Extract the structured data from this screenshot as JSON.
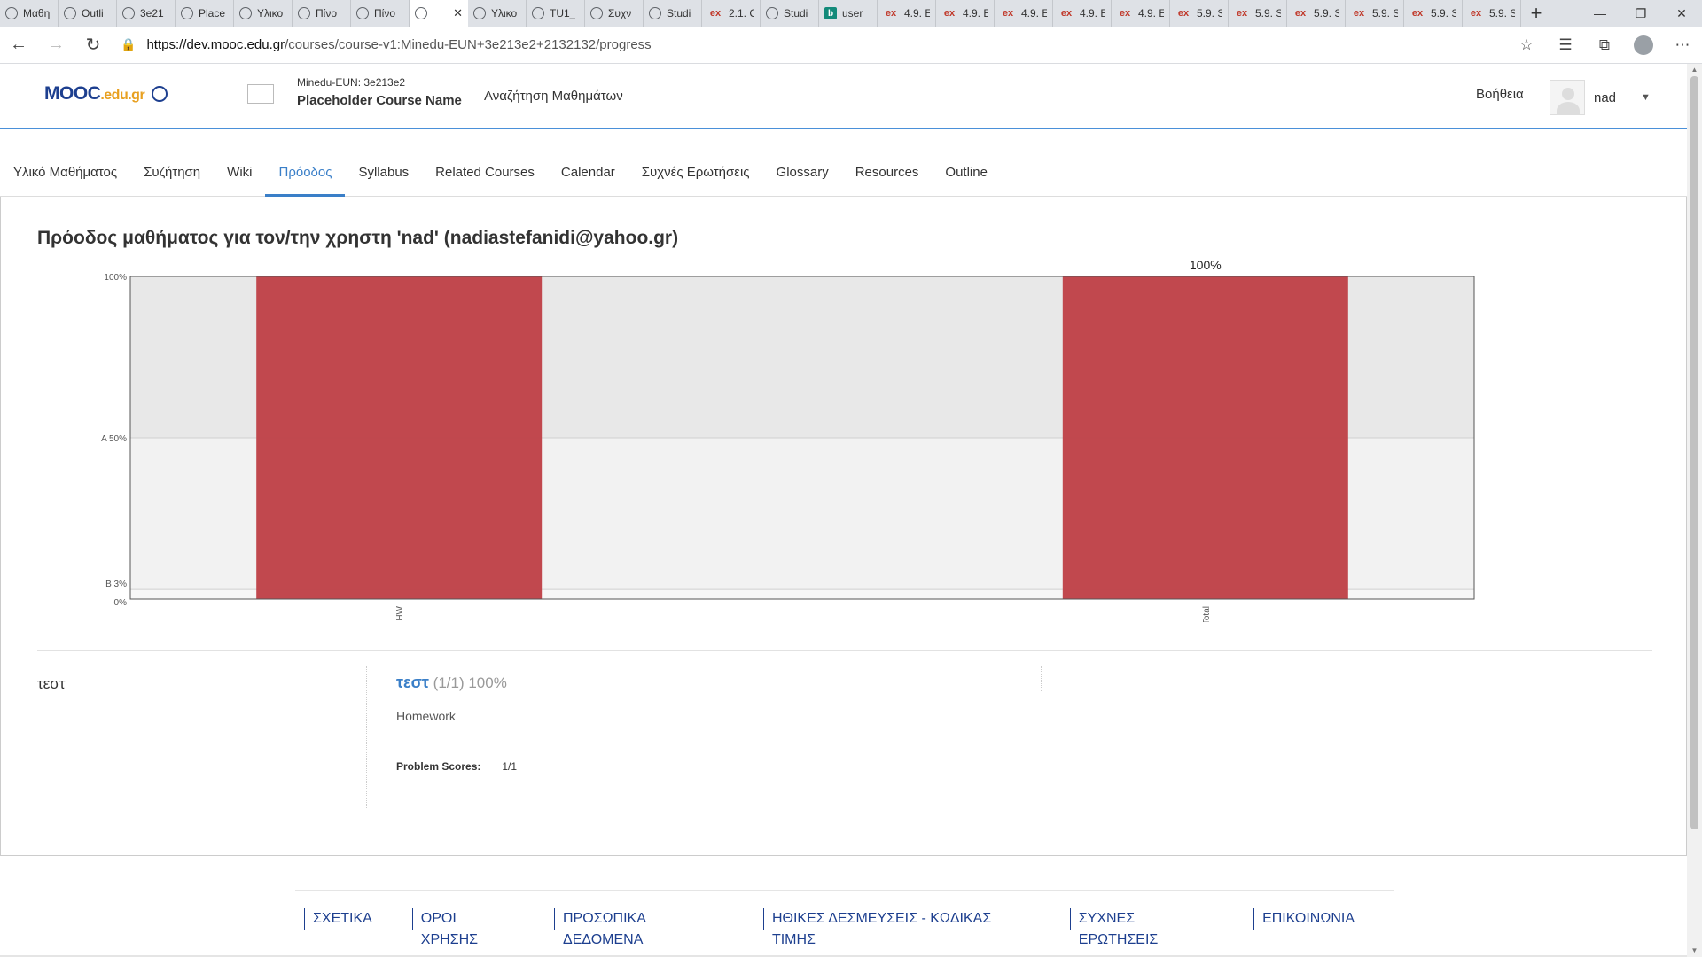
{
  "browser": {
    "tabs": [
      {
        "title": "Μαθη",
        "icon": "globe"
      },
      {
        "title": "Outli",
        "icon": "globe"
      },
      {
        "title": "3e21",
        "icon": "globe"
      },
      {
        "title": "Place",
        "icon": "globe"
      },
      {
        "title": "Υλικο",
        "icon": "globe"
      },
      {
        "title": "Πίνο",
        "icon": "globe"
      },
      {
        "title": "Πίνο",
        "icon": "globe"
      },
      {
        "title": "",
        "icon": "globe",
        "active": true
      },
      {
        "title": "Υλικο",
        "icon": "globe"
      },
      {
        "title": "TU1_",
        "icon": "globe"
      },
      {
        "title": "Συχν",
        "icon": "globe"
      },
      {
        "title": "Studi",
        "icon": "globe"
      },
      {
        "title": "2.1. C",
        "icon": "edx"
      },
      {
        "title": "Studi",
        "icon": "globe"
      },
      {
        "title": "user",
        "icon": "bing"
      },
      {
        "title": "4.9. E",
        "icon": "edx"
      },
      {
        "title": "4.9. E",
        "icon": "edx"
      },
      {
        "title": "4.9. E",
        "icon": "edx"
      },
      {
        "title": "4.9. E",
        "icon": "edx"
      },
      {
        "title": "4.9. E",
        "icon": "edx"
      },
      {
        "title": "5.9. S",
        "icon": "edx"
      },
      {
        "title": "5.9. S",
        "icon": "edx"
      },
      {
        "title": "5.9. S",
        "icon": "edx"
      },
      {
        "title": "5.9. S",
        "icon": "edx"
      },
      {
        "title": "5.9. S",
        "icon": "edx"
      },
      {
        "title": "5.9. S",
        "icon": "edx"
      }
    ],
    "url_host": "https://dev.mooc.edu.gr",
    "url_path": "/courses/course-v1:Minedu-EUN+3e213e2+2132132/progress"
  },
  "header": {
    "logo_mooc": "MOOC",
    "logo_edu": ".edu.gr",
    "course_code": "Minedu-EUN: 3e213e2",
    "course_name": "Placeholder Course Name",
    "search_link": "Αναζήτηση Μαθημάτων",
    "help": "Βοήθεια",
    "username": "nad"
  },
  "nav": {
    "tabs": [
      {
        "label": "Υλικό Μαθήματος"
      },
      {
        "label": "Συζήτηση"
      },
      {
        "label": "Wiki"
      },
      {
        "label": "Πρόοδος",
        "active": true
      },
      {
        "label": "Syllabus"
      },
      {
        "label": "Related Courses"
      },
      {
        "label": "Calendar"
      },
      {
        "label": "Συχνές Ερωτήσεις"
      },
      {
        "label": "Glossary"
      },
      {
        "label": "Resources"
      },
      {
        "label": "Outline"
      }
    ]
  },
  "progress": {
    "title": "Πρόοδος μαθήματος για τον/την χρηστη 'nad' (nadiastefanidi@yahoo.gr)"
  },
  "chart_data": {
    "type": "bar",
    "categories": [
      "HW",
      "Total"
    ],
    "values": [
      100,
      100
    ],
    "unit": "%",
    "ylim": [
      0,
      100
    ],
    "y_ticks": [
      {
        "value": 100,
        "label": "100%"
      },
      {
        "value": 50,
        "label": "A 50%"
      },
      {
        "value": 3,
        "label": "B 3%"
      },
      {
        "value": 0,
        "label": "0%"
      }
    ],
    "grade_bands": [
      {
        "from": 50,
        "to": 100,
        "color": "#e8e8e8"
      },
      {
        "from": 3,
        "to": 50,
        "color": "#f2f2f2"
      },
      {
        "from": 0,
        "to": 3,
        "color": "#f7f7f7"
      }
    ],
    "data_labels": [
      "",
      "100%"
    ],
    "bar_color": "#c0444a"
  },
  "section": {
    "name": "τεστ",
    "subsection_link": "τεστ",
    "subsection_score": "(1/1) 100%",
    "format": "Homework",
    "problem_scores_label": "Problem Scores:",
    "problem_scores_value": "1/1"
  },
  "footer": {
    "links": [
      "ΣΧΕΤΙΚΑ",
      "ΟΡΟΙ ΧΡΗΣΗΣ",
      "ΠΡΟΣΩΠΙΚΑ ΔΕΔΟΜΕΝΑ",
      "ΗΘΙΚΕΣ ΔΕΣΜΕΥΣΕΙΣ - ΚΩΔΙΚΑΣ ΤΙΜΗΣ",
      "ΣΥΧΝΕΣ ΕΡΩΤΗΣΕΙΣ",
      "ΕΠΙΚΟΙΝΩΝΙΑ"
    ]
  }
}
